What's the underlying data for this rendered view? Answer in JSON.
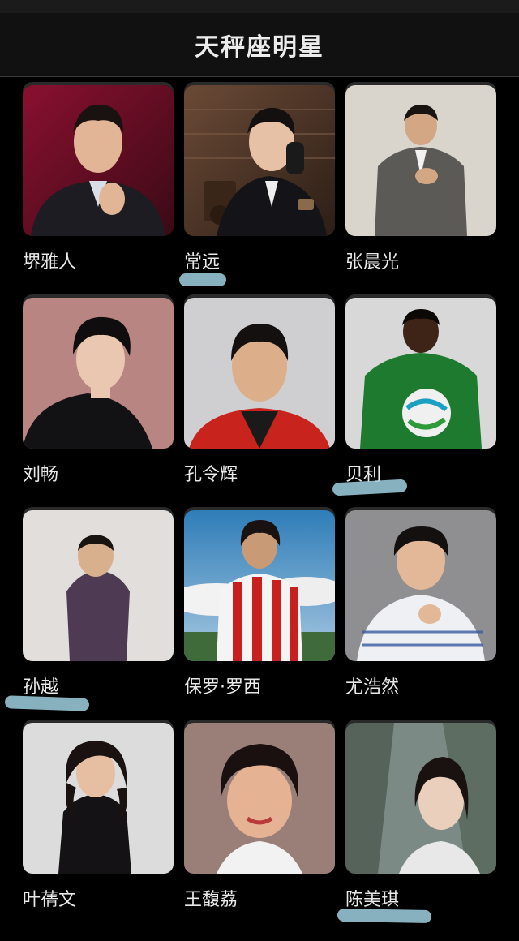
{
  "header": {
    "title": "天秤座明星"
  },
  "celebrities": [
    {
      "name": "堺雅人"
    },
    {
      "name": "常远"
    },
    {
      "name": "张晨光"
    },
    {
      "name": "刘畅"
    },
    {
      "name": "孔令辉"
    },
    {
      "name": "贝利"
    },
    {
      "name": "孙越"
    },
    {
      "name": "保罗·罗西"
    },
    {
      "name": "尤浩然"
    },
    {
      "name": "叶蒨文"
    },
    {
      "name": "王馥荔"
    },
    {
      "name": "陈美琪"
    }
  ]
}
